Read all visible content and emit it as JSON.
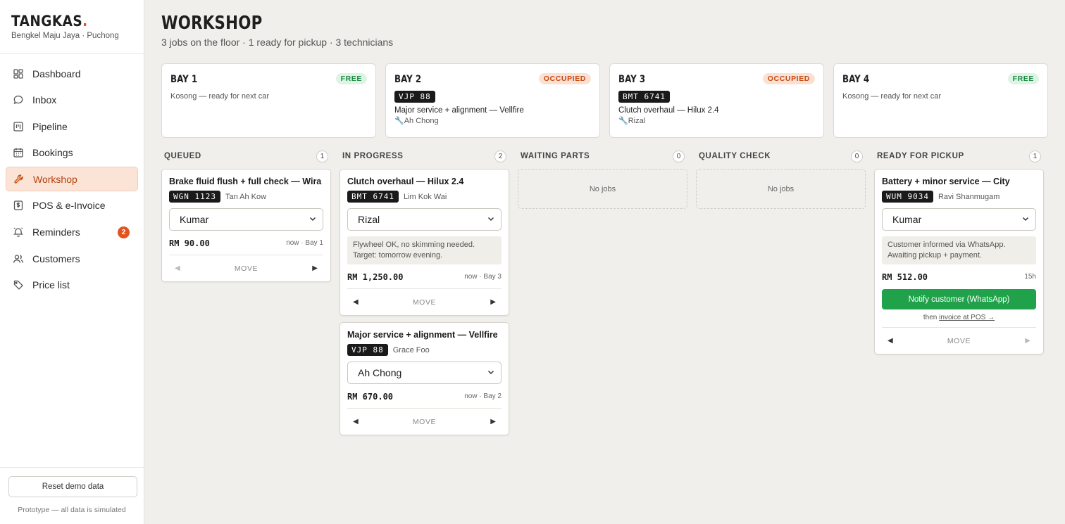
{
  "brand": {
    "name": "TANGKAS",
    "dot": ".",
    "subtitle": "Bengkel Maju Jaya · Puchong"
  },
  "nav": [
    {
      "label": "Dashboard",
      "icon": "dashboard-icon"
    },
    {
      "label": "Inbox",
      "icon": "chat-bubble-icon"
    },
    {
      "label": "Pipeline",
      "icon": "kanban-icon"
    },
    {
      "label": "Bookings",
      "icon": "calendar-icon"
    },
    {
      "label": "Workshop",
      "icon": "wrench-icon",
      "active": true
    },
    {
      "label": "POS & e-Invoice",
      "icon": "dollar-receipt-icon"
    },
    {
      "label": "Reminders",
      "icon": "bell-icon",
      "badge": "2"
    },
    {
      "label": "Customers",
      "icon": "users-icon"
    },
    {
      "label": "Price list",
      "icon": "tag-icon"
    }
  ],
  "footer": {
    "reset_label": "Reset demo data",
    "note": "Prototype — all data is simulated"
  },
  "page": {
    "title": "WORKSHOP",
    "subtitle": "3 jobs on the floor · 1 ready for pickup · 3 technicians"
  },
  "bays": [
    {
      "name": "BAY 1",
      "status": "FREE",
      "empty_text": "Kosong — ready for next car"
    },
    {
      "name": "BAY 2",
      "status": "OCCUPIED",
      "plate": "VJP 88",
      "job": "Major service + alignment — Vellfire",
      "tech": "🔧Ah Chong"
    },
    {
      "name": "BAY 3",
      "status": "OCCUPIED",
      "plate": "BMT 6741",
      "job": "Clutch overhaul — Hilux 2.4",
      "tech": "🔧Rizal"
    },
    {
      "name": "BAY 4",
      "status": "FREE",
      "empty_text": "Kosong — ready for next car"
    }
  ],
  "columns": [
    {
      "title": "QUEUED",
      "count": "1",
      "cards": [
        {
          "title": "Brake fluid flush + full check — Wira",
          "plate": "WGN 1123",
          "customer": "Tan Ah Kow",
          "tech": "Kumar",
          "price": "RM 90.00",
          "when": "now · Bay 1",
          "move": "MOVE",
          "left_dim": true,
          "right_dim": false
        }
      ]
    },
    {
      "title": "IN PROGRESS",
      "count": "2",
      "cards": [
        {
          "title": "Clutch overhaul — Hilux 2.4",
          "plate": "BMT 6741",
          "customer": "Lim Kok Wai",
          "tech": "Rizal",
          "note": "Flywheel OK, no skimming needed. Target: tomorrow evening.",
          "price": "RM 1,250.00",
          "when": "now · Bay 3",
          "move": "MOVE",
          "left_dim": false,
          "right_dim": false
        },
        {
          "title": "Major service + alignment — Vellfire",
          "plate": "VJP 88",
          "customer": "Grace Foo",
          "tech": "Ah Chong",
          "price": "RM 670.00",
          "when": "now · Bay 2",
          "move": "MOVE",
          "left_dim": false,
          "right_dim": false
        }
      ]
    },
    {
      "title": "WAITING PARTS",
      "count": "0",
      "empty_text": "No jobs",
      "cards": []
    },
    {
      "title": "QUALITY CHECK",
      "count": "0",
      "empty_text": "No jobs",
      "cards": []
    },
    {
      "title": "READY FOR PICKUP",
      "count": "1",
      "cards": [
        {
          "title": "Battery + minor service — City",
          "plate": "WUM 9034",
          "customer": "Ravi Shanmugam",
          "tech": "Kumar",
          "note": "Customer informed via WhatsApp. Awaiting pickup + payment.",
          "price": "RM 512.00",
          "when": "15h",
          "notify_label": "Notify customer (WhatsApp)",
          "then_text": "then ",
          "then_link": "invoice at POS →",
          "move": "MOVE",
          "left_dim": false,
          "right_dim": true
        }
      ]
    }
  ],
  "colors": {
    "accent": "#e2541c",
    "green": "#1fa24a",
    "active_bg": "#fbe3d6"
  }
}
